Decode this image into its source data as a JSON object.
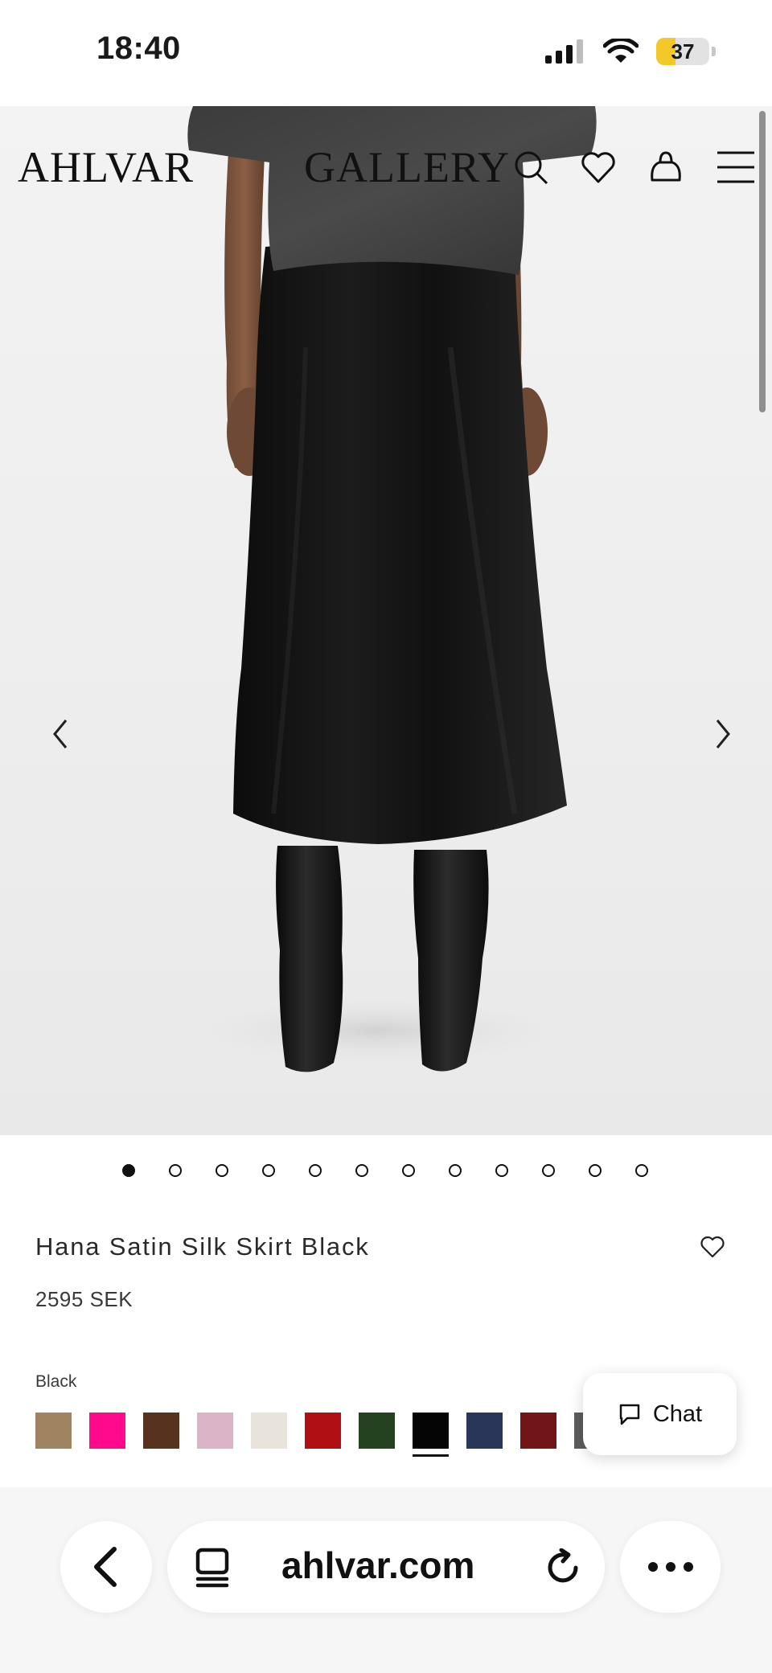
{
  "status_bar": {
    "time": "18:40",
    "battery_level": "37",
    "battery_fraction": 0.37
  },
  "header": {
    "logo": "AHLVAR",
    "gallery": "GALLERY",
    "icons": [
      "search-icon",
      "heart-icon",
      "bag-icon",
      "menu-icon"
    ]
  },
  "gallery": {
    "image_count": 12,
    "active_index": 0,
    "icons": [
      "chevron-left-icon",
      "chevron-right-icon"
    ]
  },
  "product": {
    "name": "Hana Satin Silk Skirt Black",
    "price": "2595 SEK",
    "color_label": "Black",
    "swatches": [
      {
        "color": "#a08462",
        "selected": false
      },
      {
        "color": "#ff0a8c",
        "selected": false
      },
      {
        "color": "#57331f",
        "selected": false
      },
      {
        "color": "#dcb4c8",
        "selected": false
      },
      {
        "color": "#e8e4db",
        "selected": false
      },
      {
        "color": "#b00f14",
        "selected": false
      },
      {
        "color": "#24421f",
        "selected": false
      },
      {
        "color": "#050505",
        "selected": true
      },
      {
        "color": "#2a3659",
        "selected": false
      },
      {
        "color": "#721518",
        "selected": false
      },
      {
        "color": "#5c5c5c",
        "selected": false
      }
    ]
  },
  "chat": {
    "label": "Chat",
    "icon": "chat-bubble-icon"
  },
  "browser_bar": {
    "url": "ahlvar.com",
    "icons": [
      "back-arrow-icon",
      "tabs-icon",
      "reload-icon",
      "more-icon"
    ]
  }
}
